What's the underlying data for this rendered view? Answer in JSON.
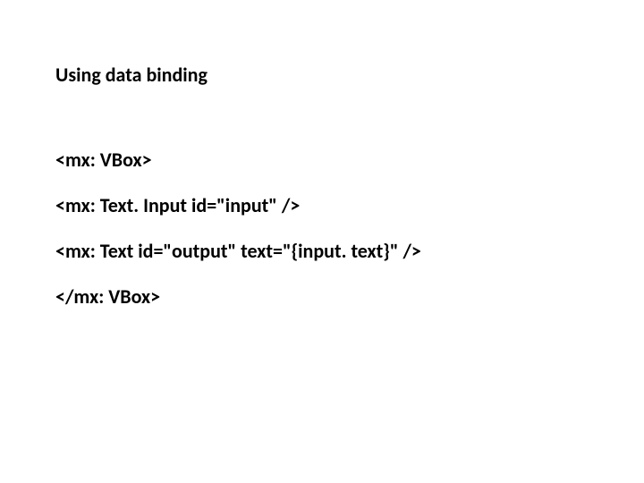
{
  "title": "Using data binding",
  "code": {
    "line1": "<mx: VBox>",
    "line2": "<mx: Text. Input id=\"input\" />",
    "line3": "<mx: Text id=\"output\" text=\"{input. text}\" />",
    "line4": "</mx: VBox>"
  }
}
